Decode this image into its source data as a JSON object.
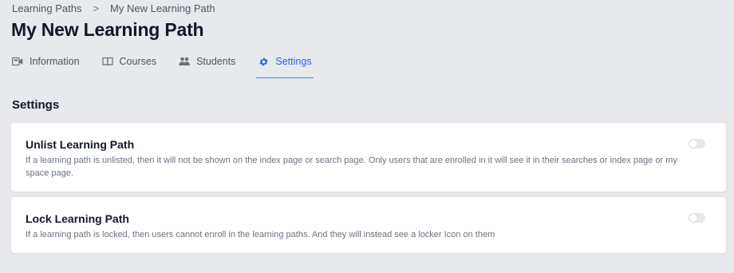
{
  "breadcrumb": {
    "items": [
      "Learning Paths",
      "My New Learning Path"
    ],
    "separator": ">"
  },
  "page_title": "My New Learning Path",
  "tabs": [
    {
      "label": "Information",
      "icon": "video-camera-icon",
      "active": false
    },
    {
      "label": "Courses",
      "icon": "book-open-icon",
      "active": false
    },
    {
      "label": "Students",
      "icon": "users-icon",
      "active": false
    },
    {
      "label": "Settings",
      "icon": "gear-icon",
      "active": true
    }
  ],
  "settings": {
    "title": "Settings",
    "items": [
      {
        "title": "Unlist Learning Path",
        "description": "If a learning path is unlisted, then it will not be shown on the index page or search page. Only users that are enrolled in it will see it in their searches or index page or my space page.",
        "enabled": false
      },
      {
        "title": "Lock Learning Path",
        "description": "If a learning path is locked, then users cannot enroll in the learning paths. And they will instead see a locker Icon on them",
        "enabled": false
      }
    ]
  },
  "colors": {
    "background": "#e8e9ed",
    "accent": "#2563eb",
    "card": "#ffffff"
  }
}
